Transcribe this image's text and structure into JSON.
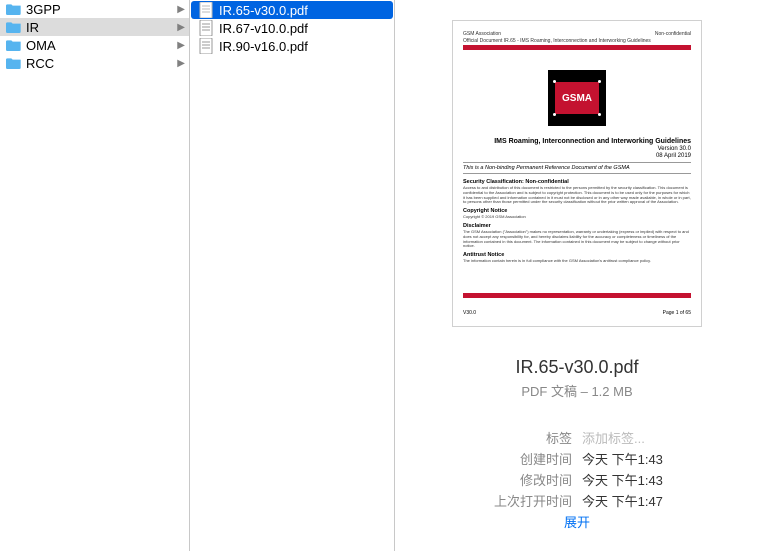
{
  "column1": {
    "items": [
      {
        "name": "3GPP",
        "selected": false
      },
      {
        "name": "IR",
        "selected": true
      },
      {
        "name": "OMA",
        "selected": false
      },
      {
        "name": "RCC",
        "selected": false
      }
    ]
  },
  "column2": {
    "items": [
      {
        "name": "IR.65-v30.0.pdf",
        "selected": true
      },
      {
        "name": "IR.67-v10.0.pdf",
        "selected": false
      },
      {
        "name": "IR.90-v16.0.pdf",
        "selected": false
      }
    ]
  },
  "preview": {
    "header_left": "GSM Association",
    "header_right": "Non-confidential",
    "header_sub": "Official Document IR.65 - IMS Roaming, Interconnection and Interworking Guidelines",
    "logo_text": "GSMA",
    "title": "IMS Roaming, Interconnection and Interworking Guidelines",
    "version": "Version 30.0",
    "date": "08 April 2019",
    "nonbinding": "This is a Non-binding Permanent Reference Document of the GSMA",
    "sec_h1": "Security Classification: Non-confidential",
    "sec_body1": "Access to and distribution of this document is restricted to the persons permitted by the security classification. This document is confidential to the Association and is subject to copyright protection. This document is to be used only for the purposes for which it has been supplied and information contained in it must not be disclosed or in any other way made available, in whole or in part, to persons other than those permitted under the security classification without the prior written approval of the Association.",
    "sec_h2": "Copyright Notice",
    "sec_body2": "Copyright © 2019 GSM Association",
    "sec_h3": "Disclaimer",
    "sec_body3": "The GSM Association (\"Association\") makes no representation, warranty or undertaking (express or implied) with respect to and does not accept any responsibility for, and hereby disclaims liability for the accuracy or completeness or timeliness of the information contained in this document. The information contained in this document may be subject to change without prior notice.",
    "sec_h4": "Antitrust Notice",
    "sec_body4": "The information contain herein is in full compliance with the GSM Association's antitrust compliance policy.",
    "footer_left": "V30.0",
    "footer_right": "Page 1 of 65"
  },
  "details": {
    "filename": "IR.65-v30.0.pdf",
    "meta": "PDF 文稿 – 1.2 MB",
    "rows": {
      "tag_label": "标签",
      "tag_placeholder": "添加标签...",
      "created_label": "创建时间",
      "created_value": "今天 下午1:43",
      "modified_label": "修改时间",
      "modified_value": "今天 下午1:43",
      "lastopen_label": "上次打开时间",
      "lastopen_value": "今天 下午1:47"
    },
    "expand": "展开"
  }
}
